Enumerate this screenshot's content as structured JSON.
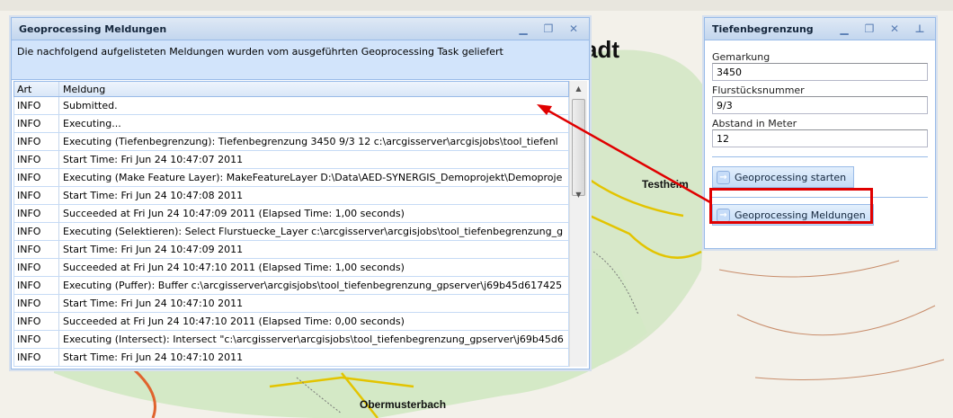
{
  "map": {
    "labels": [
      "adt",
      "Testheim",
      "Obermusterbach"
    ]
  },
  "messages_window": {
    "title": "Geoprocessing Meldungen",
    "info": "Die nachfolgend aufgelisteten Meldungen wurden vom ausgeführten Geoprocessing Task geliefert",
    "columns": [
      "Art",
      "Meldung"
    ],
    "rows": [
      [
        "INFO",
        "Submitted."
      ],
      [
        "INFO",
        "Executing..."
      ],
      [
        "INFO",
        "Executing (Tiefenbegrenzung): Tiefenbegrenzung 3450 9/3 12 c:\\arcgisserver\\arcgisjobs\\tool_tiefenl"
      ],
      [
        "INFO",
        "Start Time: Fri Jun 24 10:47:07 2011"
      ],
      [
        "INFO",
        "Executing (Make Feature Layer): MakeFeatureLayer D:\\Data\\AED-SYNERGIS_Demoprojekt\\Demoproje"
      ],
      [
        "INFO",
        "Start Time: Fri Jun 24 10:47:08 2011"
      ],
      [
        "INFO",
        "Succeeded at Fri Jun 24 10:47:09 2011 (Elapsed Time: 1,00 seconds)"
      ],
      [
        "INFO",
        "Executing (Selektieren): Select Flurstuecke_Layer c:\\arcgisserver\\arcgisjobs\\tool_tiefenbegrenzung_g"
      ],
      [
        "INFO",
        "Start Time: Fri Jun 24 10:47:09 2011"
      ],
      [
        "INFO",
        "Succeeded at Fri Jun 24 10:47:10 2011 (Elapsed Time: 1,00 seconds)"
      ],
      [
        "INFO",
        "Executing (Puffer): Buffer c:\\arcgisserver\\arcgisjobs\\tool_tiefenbegrenzung_gpserver\\j69b45d617425"
      ],
      [
        "INFO",
        "Start Time: Fri Jun 24 10:47:10 2011"
      ],
      [
        "INFO",
        "Succeeded at Fri Jun 24 10:47:10 2011 (Elapsed Time: 0,00 seconds)"
      ],
      [
        "INFO",
        "Executing (Intersect): Intersect \"c:\\arcgisserver\\arcgisjobs\\tool_tiefenbegrenzung_gpserver\\j69b45d6"
      ],
      [
        "INFO",
        "Start Time: Fri Jun 24 10:47:10 2011"
      ]
    ]
  },
  "tool_window": {
    "title": "Tiefenbegrenzung",
    "fields": [
      {
        "label": "Gemarkung",
        "value": "3450"
      },
      {
        "label": "Flurstücksnummer",
        "value": "9/3"
      },
      {
        "label": "Abstand in Meter",
        "value": "12"
      }
    ],
    "start_button": "Geoprocessing starten",
    "messages_button": "Geoprocessing Meldungen"
  },
  "colors": {
    "highlight": "#e00000",
    "accent": "#99bbe8"
  }
}
